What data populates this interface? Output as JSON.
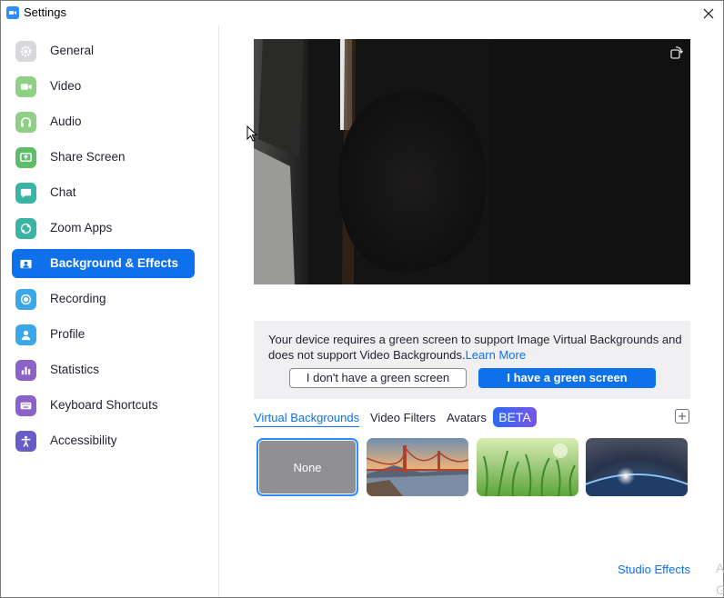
{
  "window": {
    "title": "Settings"
  },
  "sidebar": {
    "items": [
      {
        "label": "General",
        "icon": "gear-icon",
        "color": "#c5c5c9",
        "active": false
      },
      {
        "label": "Video",
        "icon": "camera-icon",
        "color": "#7ec47a",
        "active": false
      },
      {
        "label": "Audio",
        "icon": "headphones-icon",
        "color": "#7ec47a",
        "active": false
      },
      {
        "label": "Share Screen",
        "icon": "share-screen-icon",
        "color": "#5ebc6a",
        "active": false
      },
      {
        "label": "Chat",
        "icon": "chat-icon",
        "color": "#3cb4a4",
        "active": false
      },
      {
        "label": "Zoom Apps",
        "icon": "apps-icon",
        "color": "#3cb4a4",
        "active": false
      },
      {
        "label": "Background & Effects",
        "icon": "person-background-icon",
        "color": "#ffffff",
        "active": true
      },
      {
        "label": "Recording",
        "icon": "record-icon",
        "color": "#3aa8e8",
        "active": false
      },
      {
        "label": "Profile",
        "icon": "profile-icon",
        "color": "#3aa8e8",
        "active": false
      },
      {
        "label": "Statistics",
        "icon": "statistics-icon",
        "color": "#8a63c8",
        "active": false
      },
      {
        "label": "Keyboard Shortcuts",
        "icon": "keyboard-icon",
        "color": "#8a63c8",
        "active": false
      },
      {
        "label": "Accessibility",
        "icon": "accessibility-icon",
        "color": "#6a5cc8",
        "active": false
      }
    ]
  },
  "notice": {
    "text": "Your device requires a green screen to support Image Virtual Backgrounds and does not support Video Backgrounds.",
    "link": "Learn More",
    "no_button": "I don't have a green screen",
    "yes_button": "I have a green screen"
  },
  "tabs": {
    "virtual": "Virtual Backgrounds",
    "filters": "Video Filters",
    "avatars": "Avatars",
    "beta": "BETA"
  },
  "backgrounds": [
    {
      "label": "None",
      "selected": true
    },
    {
      "label": "",
      "image": "golden-gate-bridge"
    },
    {
      "label": "",
      "image": "grass"
    },
    {
      "label": "",
      "image": "earth-from-space"
    }
  ],
  "studio_effects": "Studio Effects",
  "edge_letters": {
    "a": "A",
    "g": "G"
  },
  "colors": {
    "accent": "#0e71eb",
    "active_nav": "#0e71eb",
    "beta_start": "#2a6bf0",
    "beta_end": "#7a55e8"
  }
}
